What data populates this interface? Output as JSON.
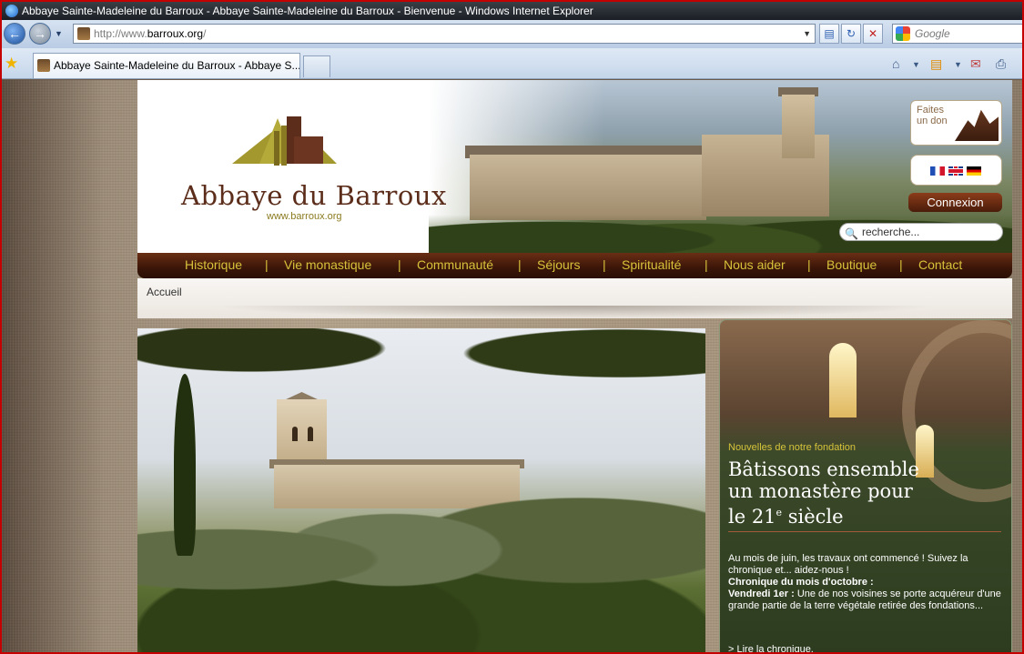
{
  "browser": {
    "title": "Abbaye Sainte-Madeleine du Barroux - Abbaye Sainte-Madeleine du Barroux - Bienvenue - Windows Internet Explorer",
    "address_prefix": "http://www.",
    "address_host": "barroux.org",
    "address_suffix": "/",
    "search_placeholder": "Google",
    "tab_label": "Abbaye Sainte-Madeleine du Barroux - Abbaye S..."
  },
  "site": {
    "logo_title": "Abbaye du Barroux",
    "logo_url": "www.barroux.org",
    "donate_label": "Faites un don",
    "login_label": "Connexion",
    "search_placeholder": "recherche...",
    "menu": [
      {
        "label": "Historique"
      },
      {
        "label": "Vie monastique"
      },
      {
        "label": "Communauté"
      },
      {
        "label": "Séjours"
      },
      {
        "label": "Spiritualité"
      },
      {
        "label": "Nous aider"
      },
      {
        "label": "Boutique"
      },
      {
        "label": "Contact"
      }
    ],
    "menu_separator": "|",
    "breadcrumb": "Accueil"
  },
  "feature": {
    "kicker": "Nouvelles de notre fondation",
    "title_line1": "Bâtissons ensemble",
    "title_line2": "un monastère pour",
    "title_line3_prefix": "le 21",
    "title_line3_sup": "e",
    "title_line3_suffix": " siècle",
    "intro": "Au mois de juin, les travaux ont commencé ! Suivez la chronique et... aidez-nous !",
    "chronicle_heading": "Chronique du mois d'octobre :",
    "entry_date": "Vendredi 1er :",
    "entry_text": " Une de nos voisines se porte acquéreur d'une grande partie de la terre végétale retirée des fondations...",
    "read_link": "> Lire la chronique."
  }
}
